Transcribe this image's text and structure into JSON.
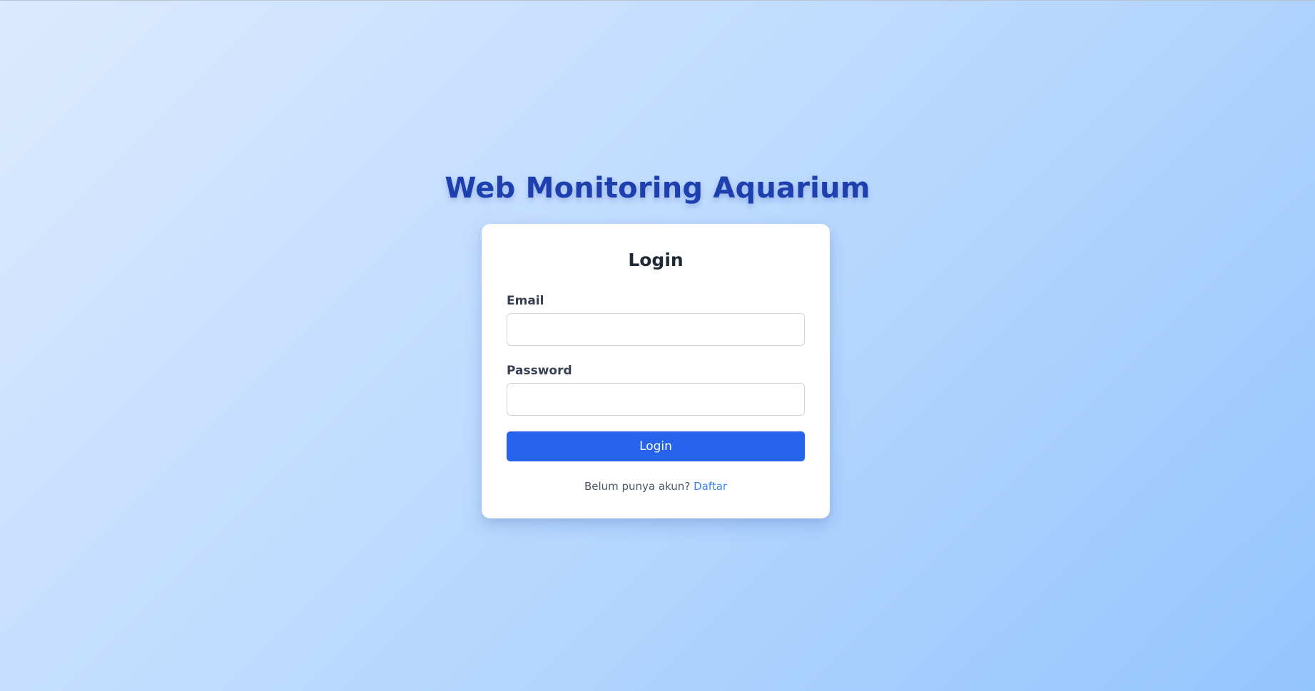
{
  "app": {
    "title": "Web Monitoring Aquarium"
  },
  "login_form": {
    "heading": "Login",
    "email_label": "Email",
    "email_value": "",
    "password_label": "Password",
    "password_value": "",
    "submit_label": "Login",
    "register_prompt": "Belum punya akun?",
    "register_link": "Daftar"
  },
  "colors": {
    "title": "#1e40af",
    "primary_button": "#2563eb",
    "link": "#3b82f6",
    "background_start": "#dbeafe",
    "background_end": "#93c5fd"
  }
}
